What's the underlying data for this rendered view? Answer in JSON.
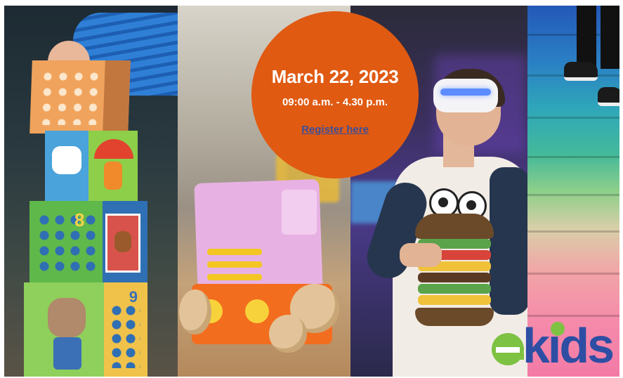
{
  "event": {
    "date": "March 22, 2023",
    "time": "09:00 a.m. - 4.30 p.m.",
    "register_link": "Register here"
  },
  "logo": {
    "text": "kids",
    "brand_color": "#2d4ea3",
    "accent_color": "#7dc242"
  },
  "colors": {
    "circle": "#e05a12",
    "circle_text": "#ffffff",
    "link": "#3d4f98"
  },
  "photos": [
    {
      "subject": "stacked toy blocks"
    },
    {
      "subject": "wooden toy truck"
    },
    {
      "subject": "teen wearing VR headset"
    },
    {
      "subject": "colorful stairs"
    }
  ]
}
